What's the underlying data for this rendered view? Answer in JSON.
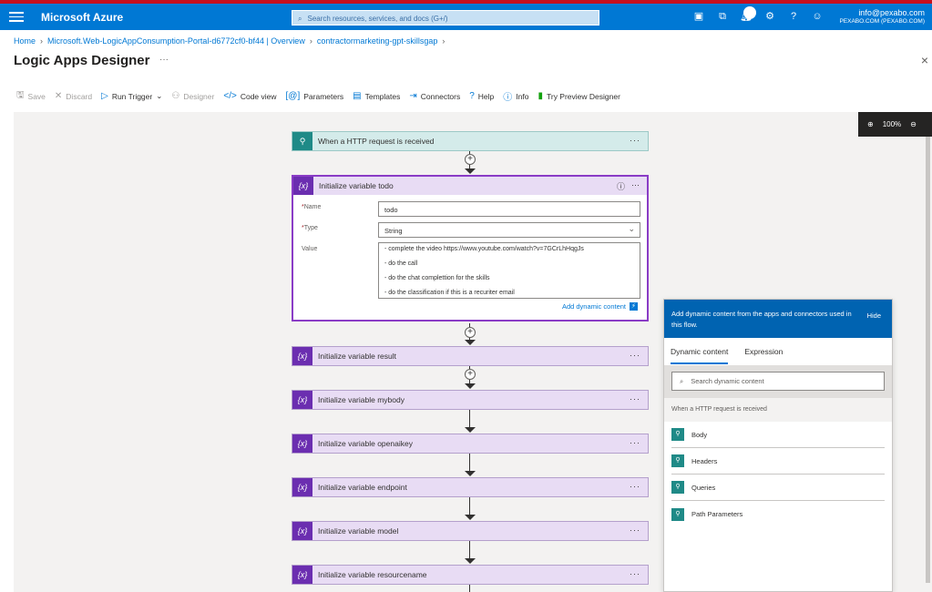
{
  "portal": {
    "brand": "Microsoft Azure",
    "search_placeholder": "Search resources, services, and docs (G+/)",
    "notification_count": "10",
    "account_email": "info@pexabo.com",
    "account_tenant": "PEXABO.COM (PEXABO.COM)"
  },
  "breadcrumb": [
    "Home",
    "Microsoft.Web-LogicAppConsumption-Portal-d6772cf0-bf44 | Overview",
    "contractormarketing-gpt-skillsgap"
  ],
  "page": {
    "title": "Logic Apps Designer",
    "more": "···",
    "close": "×"
  },
  "toolbar": {
    "save": "Save",
    "discard": "Discard",
    "run_trigger": "Run Trigger",
    "designer": "Designer",
    "code_view": "Code view",
    "parameters": "Parameters",
    "templates": "Templates",
    "connectors": "Connectors",
    "help": "Help",
    "info": "Info",
    "try_preview": "Try Preview Designer"
  },
  "zoom": {
    "level": "100%"
  },
  "flow": {
    "trigger": "When a HTTP request is received",
    "expanded_step": {
      "title": "Initialize variable todo",
      "name_label": "Name",
      "name_value": "todo",
      "type_label": "Type",
      "type_value": "String",
      "value_label": "Value",
      "value_lines": [
        "- complete the video https://www.youtube.com/watch?v=7GCrLhHqgJs",
        "- do the call",
        "- do the chat complettion for the skills",
        "- do the classification if this is a recuriter email"
      ],
      "add_dynamic": "Add dynamic content"
    },
    "steps": [
      "Initialize variable result",
      "Initialize variable mybody",
      "Initialize variable openaikey",
      "Initialize variable endpoint",
      "Initialize variable model",
      "Initialize variable resourcename"
    ]
  },
  "dynamic_panel": {
    "description": "Add dynamic content from the apps and connectors used in this flow.",
    "hide": "Hide",
    "tabs": [
      "Dynamic content",
      "Expression"
    ],
    "search_placeholder": "Search dynamic content",
    "group": "When a HTTP request is received",
    "items": [
      "Body",
      "Headers",
      "Queries",
      "Path Parameters"
    ]
  }
}
